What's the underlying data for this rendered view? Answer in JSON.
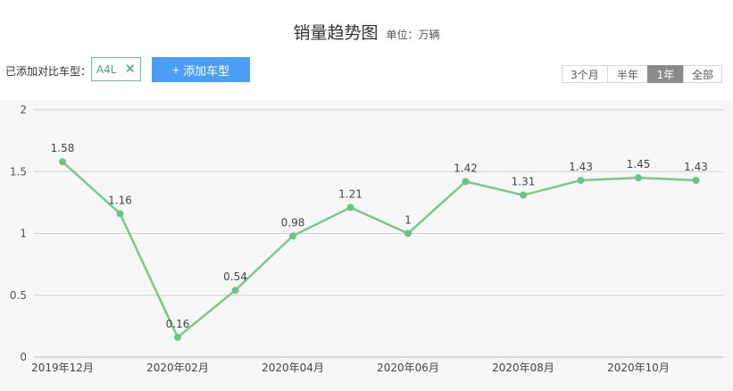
{
  "header": {
    "title": "销量趋势图",
    "unit": "单位：万辆"
  },
  "compare": {
    "label": "已添加对比车型：",
    "tag": "A4L",
    "add_button": "添加车型"
  },
  "range": {
    "options": [
      "3个月",
      "半年",
      "1年",
      "全部"
    ],
    "selected": "1年"
  },
  "colors": {
    "line": "#79c98b",
    "point": "#6cc38a",
    "accent": "#4b9ef5"
  },
  "chart_data": {
    "type": "line",
    "x": [
      "2019年12月",
      "2020年01月",
      "2020年02月",
      "2020年03月",
      "2020年04月",
      "2020年05月",
      "2020年06月",
      "2020年07月",
      "2020年08月",
      "2020年09月",
      "2020年10月",
      "2020年11月"
    ],
    "values": [
      1.58,
      1.16,
      0.16,
      0.54,
      0.98,
      1.21,
      1.0,
      1.42,
      1.31,
      1.43,
      1.45,
      1.43
    ],
    "value_labels": [
      "1.58",
      "1.16",
      "0.16",
      "0.54",
      "0.98",
      "1.21",
      "1",
      "1.42",
      "1.31",
      "1.43",
      "1.45",
      "1.43"
    ],
    "x_tick_labels": [
      "2019年12月",
      "2020年02月",
      "2020年04月",
      "2020年06月",
      "2020年08月",
      "2020年10月"
    ],
    "y_ticks": [
      "0",
      "0.5",
      "1",
      "1.5",
      "2"
    ],
    "ylim": [
      0,
      2
    ],
    "grid": true
  }
}
